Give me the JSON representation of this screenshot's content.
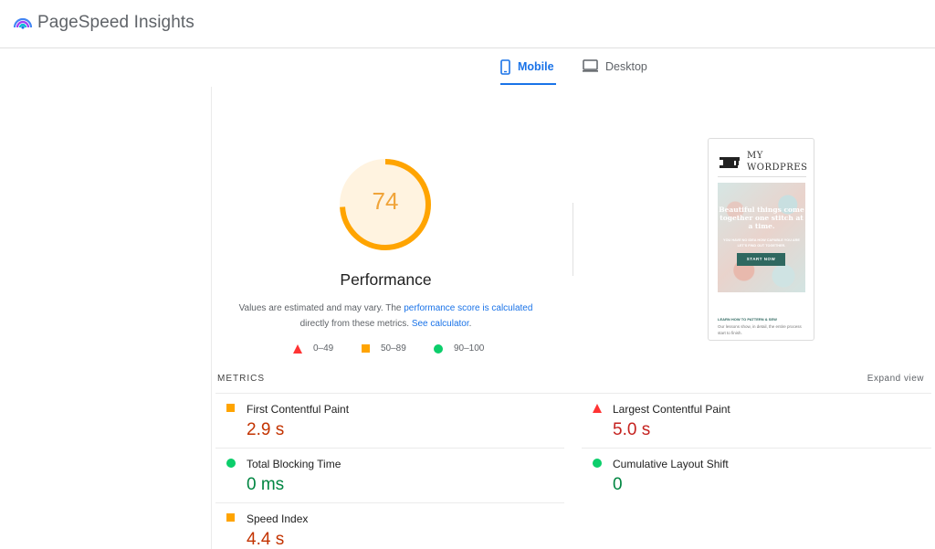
{
  "app": {
    "title": "PageSpeed Insights"
  },
  "tabs": [
    {
      "label": "Mobile",
      "active": true,
      "icon": "phone-icon"
    },
    {
      "label": "Desktop",
      "active": false,
      "icon": "monitor-icon"
    }
  ],
  "score": {
    "value": "74",
    "fraction": 0.74,
    "title": "Performance",
    "color": "#ffa400",
    "track_color": "#fff3e0"
  },
  "description": {
    "text1": "Values are estimated and may vary. The ",
    "link1": "performance score is calculated",
    "text2": " directly from these metrics. ",
    "link2": "See calculator",
    "text3": "."
  },
  "legend": [
    {
      "label": "0–49",
      "icon": "triangle-red-icon",
      "color": "#ff3333"
    },
    {
      "label": "50–89",
      "icon": "square-orange-icon",
      "color": "#ffa400"
    },
    {
      "label": "90–100",
      "icon": "circle-green-icon",
      "color": "#0cce6b"
    }
  ],
  "thumbnail": {
    "brand_line1": "MY",
    "brand_line2": "WORDPRES",
    "headline": "Beautiful things come together one stitch at a time.",
    "subline": "YOU HAVE NO IDEA HOW CAPABLE YOU ARE LET'S FIND OUT TOGETHER.",
    "button": "START NOW",
    "learn": "LEARN HOW TO PATTERN & SEW",
    "body": "Our lessons show, in detail, the entire process start to finish."
  },
  "metrics_section": {
    "label": "METRICS",
    "expand": "Expand view"
  },
  "metrics": {
    "fcp": {
      "name": "First Contentful Paint",
      "value": "2.9 s",
      "status": "average"
    },
    "lcp": {
      "name": "Largest Contentful Paint",
      "value": "5.0 s",
      "status": "fail"
    },
    "tbt": {
      "name": "Total Blocking Time",
      "value": "0 ms",
      "status": "pass"
    },
    "cls": {
      "name": "Cumulative Layout Shift",
      "value": "0",
      "status": "pass"
    },
    "si": {
      "name": "Speed Index",
      "value": "4.4 s",
      "status": "average"
    }
  }
}
